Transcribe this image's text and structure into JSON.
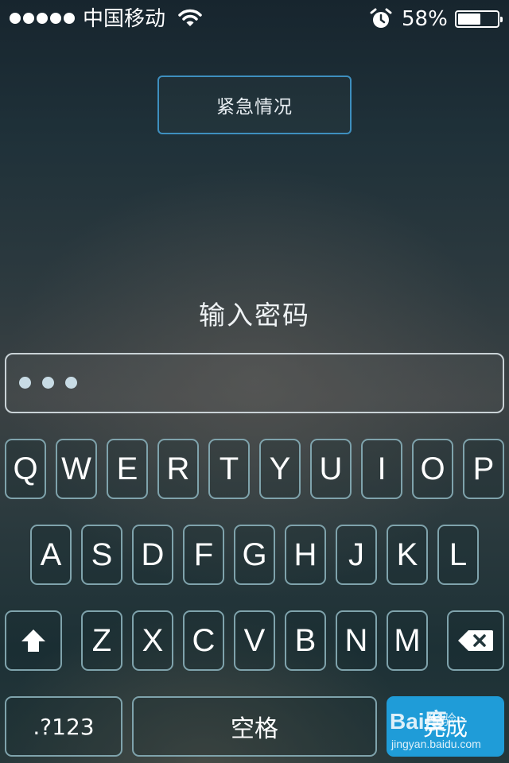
{
  "status_bar": {
    "carrier": "中国移动",
    "battery_percent": "58%",
    "battery_level": 0.58,
    "signal_bars": 5,
    "icons": [
      "wifi-icon",
      "alarm-icon",
      "battery-icon"
    ]
  },
  "emergency_button": {
    "label": "紧急情况"
  },
  "prompt": {
    "text": "输入密码"
  },
  "password": {
    "masked_count": 3
  },
  "keyboard": {
    "row1": [
      "Q",
      "W",
      "E",
      "R",
      "T",
      "Y",
      "U",
      "I",
      "O",
      "P"
    ],
    "row2": [
      "A",
      "S",
      "D",
      "F",
      "G",
      "H",
      "J",
      "K",
      "L"
    ],
    "row3": [
      "Z",
      "X",
      "C",
      "V",
      "B",
      "N",
      "M"
    ],
    "shift_icon": "shift-arrow-icon",
    "delete_icon": "backspace-icon",
    "numbers_label": ".?123",
    "space_label": "空格",
    "done_label": "完成"
  },
  "watermark": {
    "logo": "Bai度",
    "sub": "经验",
    "url": "jingyan.baidu.com"
  },
  "colors": {
    "emergency_border": "#3e8fbf",
    "done_key": "#1f9cd8",
    "key_border": "#7fa3ac"
  }
}
